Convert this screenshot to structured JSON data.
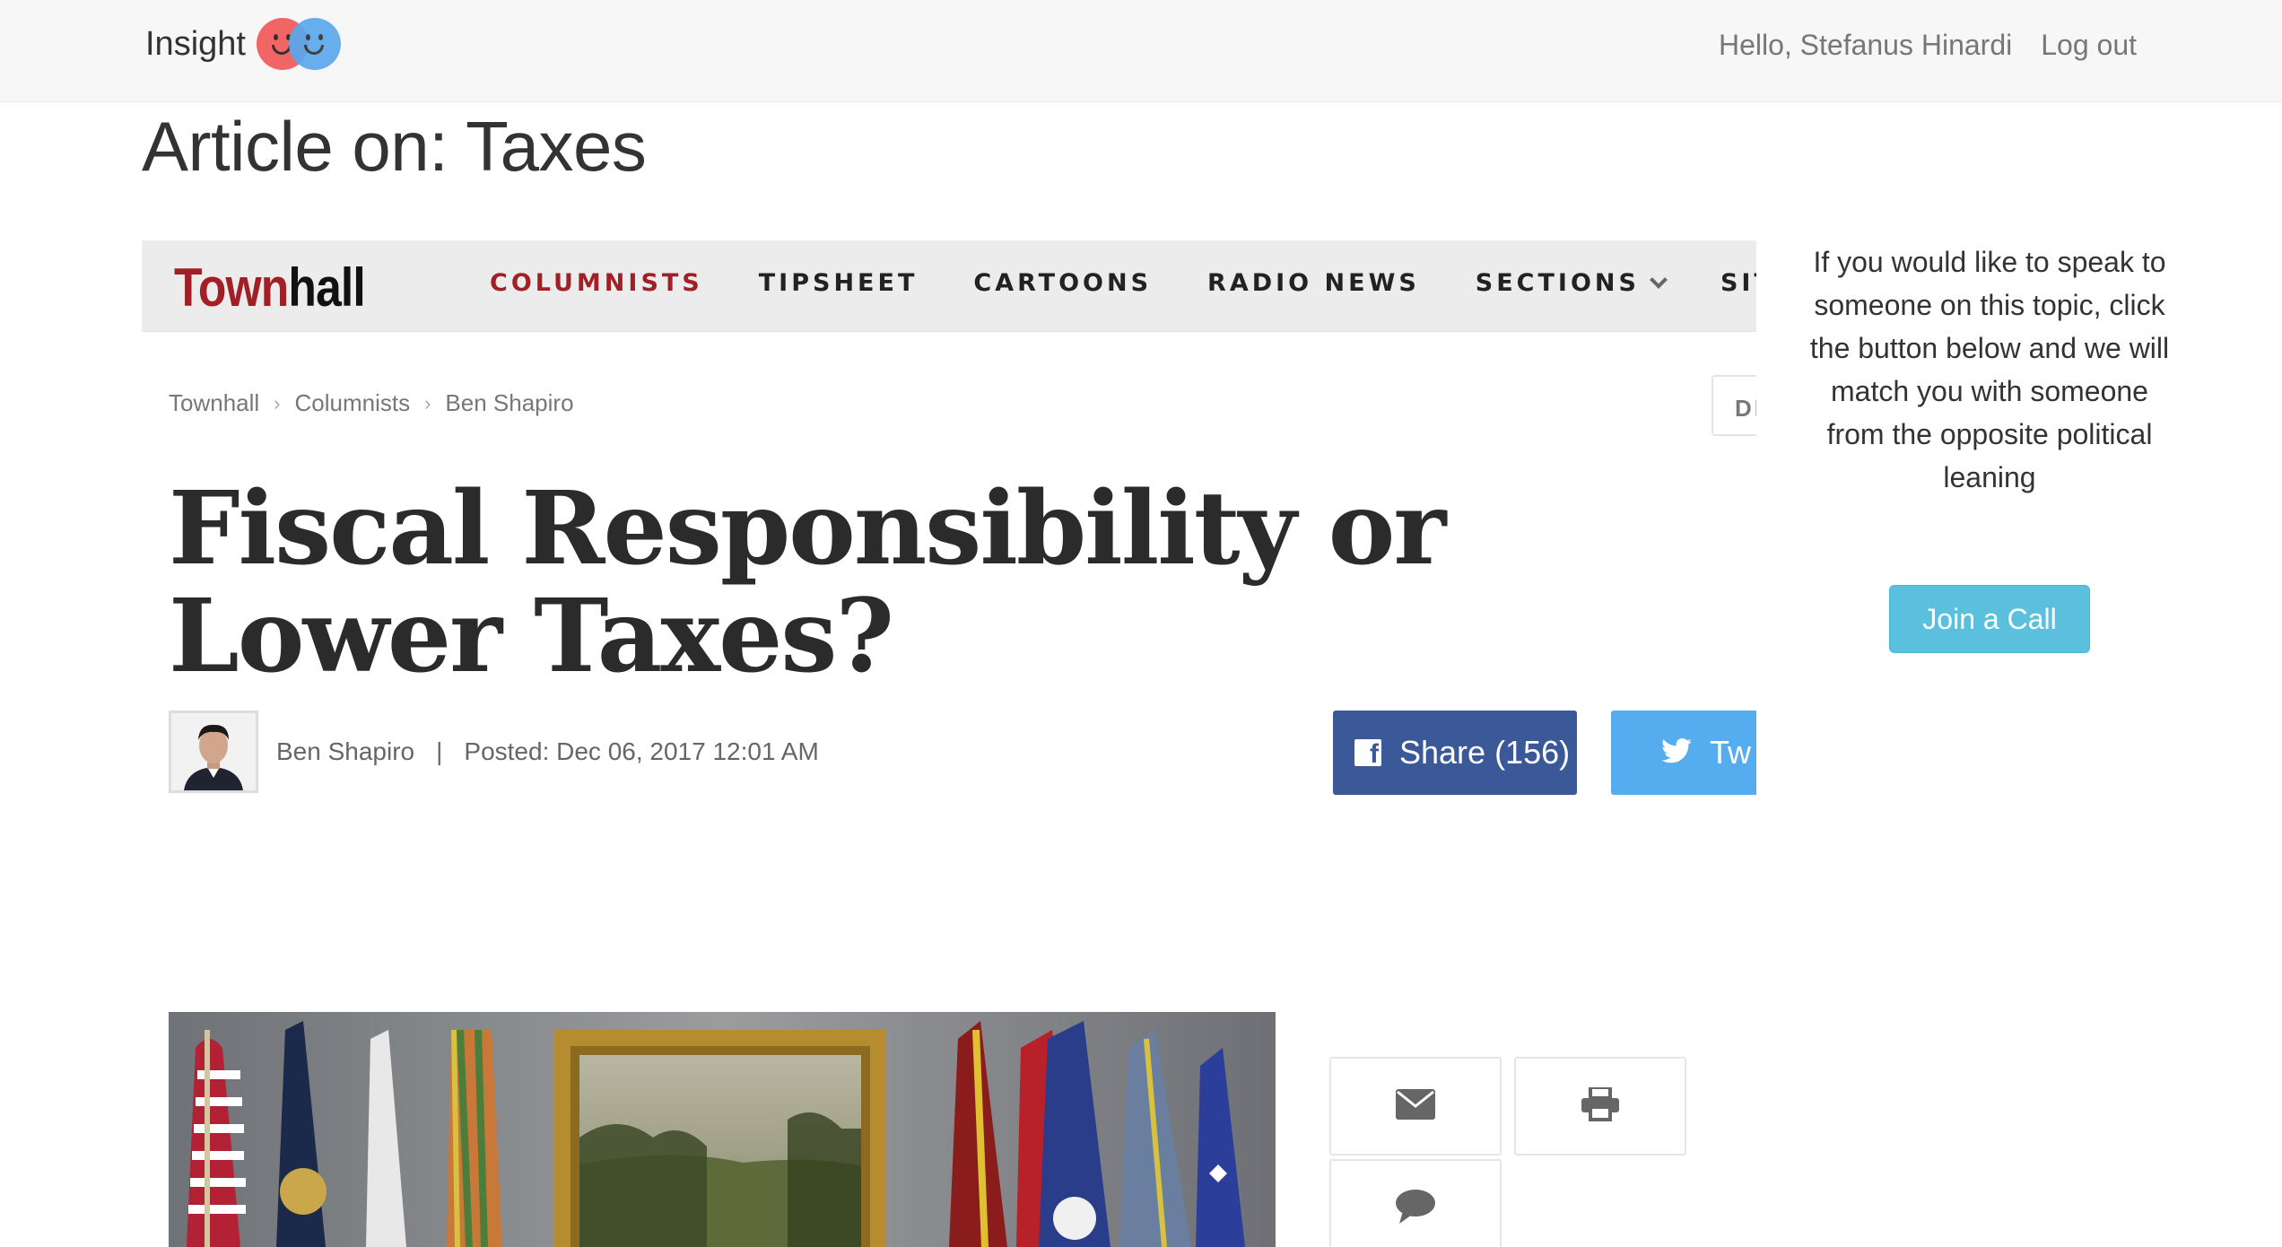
{
  "navbar": {
    "brand": "Insight",
    "greeting": "Hello, Stefanus Hinardi",
    "logout": "Log out"
  },
  "page": {
    "title": "Article on: Taxes"
  },
  "townhall": {
    "logo_part1": "Town",
    "logo_part2": "hall",
    "menu": [
      "COLUMNISTS",
      "TIPSHEET",
      "CARTOONS",
      "RADIO NEWS",
      "SECTIONS",
      "SITES"
    ],
    "breadcrumbs": [
      "Townhall",
      "Columnists",
      "Ben Shapiro"
    ],
    "side_box_text": "DE",
    "headline": "Fiscal Responsibility or Lower Taxes?",
    "author": "Ben Shapiro",
    "posted": "Posted: Dec 06, 2017 12:01 AM",
    "fb_share": "Share (156)",
    "tw_label": "Tw",
    "colors": {
      "accent": "#a21f26",
      "facebook": "#3b5998",
      "twitter": "#55acee"
    }
  },
  "sidebar": {
    "cta": "If you would like to speak to someone on this topic, click the button below and we will match you with someone from the opposite political leaning",
    "button": "Join a Call",
    "button_color": "#5bc0de"
  }
}
